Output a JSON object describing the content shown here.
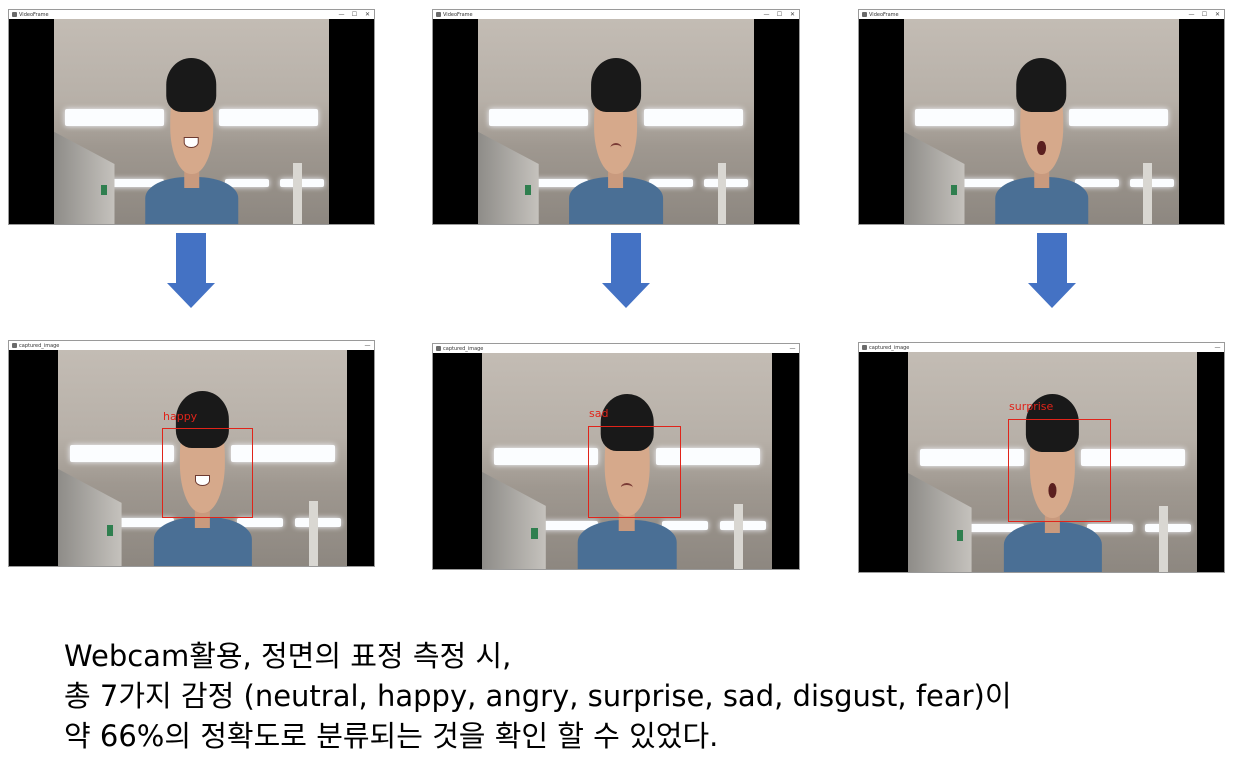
{
  "top_windows": [
    {
      "title": "VideoFrame",
      "controls": [
        "—",
        "☐",
        "✕"
      ],
      "expression": "happy"
    },
    {
      "title": "VideoFrame",
      "controls": [
        "—",
        "☐",
        "✕"
      ],
      "expression": "sad"
    },
    {
      "title": "VideoFrame",
      "controls": [
        "—",
        "☐",
        "✕"
      ],
      "expression": "surprise"
    }
  ],
  "bottom_windows": [
    {
      "title": "captured_image",
      "controls": [
        "—"
      ],
      "label": "happy"
    },
    {
      "title": "captured_image",
      "controls": [
        "—"
      ],
      "label": "sad"
    },
    {
      "title": "captured_image",
      "controls": [
        "—"
      ],
      "label": "surprise"
    }
  ],
  "arrows": [
    "arrow-down-icon",
    "arrow-down-icon",
    "arrow-down-icon"
  ],
  "colors": {
    "arrow": "#4472c4",
    "detection": "#e0241a",
    "frame_background": "#000000"
  },
  "caption": {
    "line1": "Webcam활용, 정면의 표정 측정 시,",
    "line2": "총 7가지 감정 (neutral, happy, angry, surprise, sad, disgust, fear)이",
    "line3": "약 66%의 정확도로 분류되는 것을 확인 할 수 있었다."
  }
}
